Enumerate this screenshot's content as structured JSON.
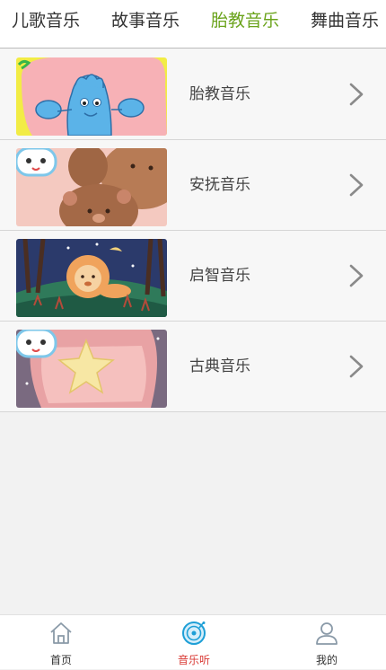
{
  "tabs": [
    {
      "label": "儿歌音乐",
      "active": false
    },
    {
      "label": "故事音乐",
      "active": false
    },
    {
      "label": "胎教音乐",
      "active": true
    },
    {
      "label": "舞曲音乐",
      "active": false
    }
  ],
  "list": [
    {
      "label": "胎教音乐",
      "thumb": "blue-monster-thumbnail"
    },
    {
      "label": "安抚音乐",
      "thumb": "teddy-bears-thumbnail"
    },
    {
      "label": "启智音乐",
      "thumb": "lion-forest-thumbnail"
    },
    {
      "label": "古典音乐",
      "thumb": "star-pillow-thumbnail"
    }
  ],
  "bottom_nav": [
    {
      "label": "首页",
      "icon": "home-icon",
      "active": false
    },
    {
      "label": "音乐听",
      "icon": "music-disc-icon",
      "active": true
    },
    {
      "label": "我的",
      "icon": "user-icon",
      "active": false
    }
  ],
  "colors": {
    "active_tab": "#6aa31b",
    "active_nav": "#d93a35",
    "nav_icon_active": "#1e9fd6",
    "nav_icon_inactive": "#8a9aa8"
  }
}
